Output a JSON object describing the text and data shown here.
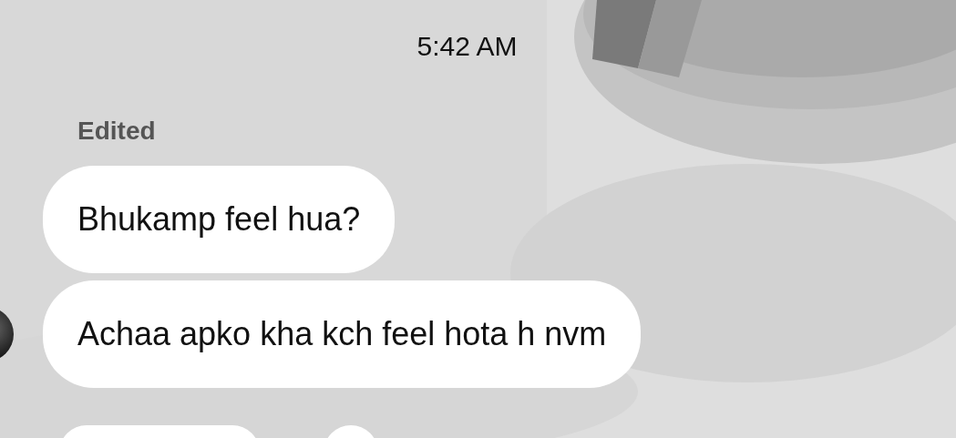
{
  "timestamp": "5:42 AM",
  "messages": [
    {
      "note": "Edited",
      "text": "Bhukamp feel hua?"
    },
    {
      "text": "Achaa apko kha kch feel hota h nvm",
      "avatar": true
    }
  ]
}
